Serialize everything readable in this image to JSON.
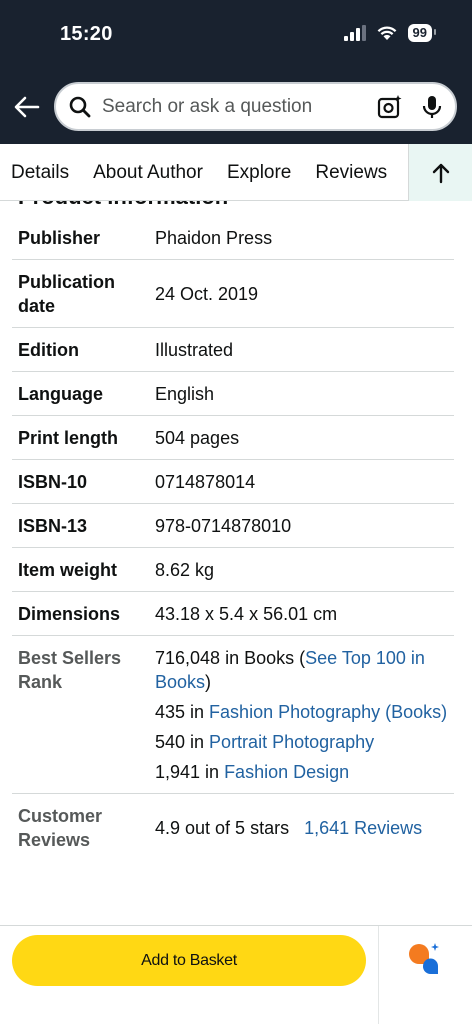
{
  "status_bar": {
    "time": "15:20",
    "battery": "99"
  },
  "search": {
    "placeholder": "Search or ask a question"
  },
  "tabs": [
    {
      "label": "Details"
    },
    {
      "label": "About Author"
    },
    {
      "label": "Explore"
    },
    {
      "label": "Reviews"
    }
  ],
  "section_title": "Product information",
  "details": {
    "publisher": {
      "key": "Publisher",
      "value": "Phaidon Press"
    },
    "publication_date": {
      "key": "Publication date",
      "value": "24 Oct. 2019"
    },
    "edition": {
      "key": "Edition",
      "value": "Illustrated"
    },
    "language": {
      "key": "Language",
      "value": "English"
    },
    "print_length": {
      "key": "Print length",
      "value": "504 pages"
    },
    "isbn10": {
      "key": "ISBN-10",
      "value": "0714878014"
    },
    "isbn13": {
      "key": "ISBN-13",
      "value": "978-0714878010"
    },
    "item_weight": {
      "key": "Item weight",
      "value": "8.62 kg"
    },
    "dimensions": {
      "key": "Dimensions",
      "value": "43.18 x 5.4 x 56.01 cm"
    }
  },
  "best_sellers": {
    "key": "Best Sellers Rank",
    "ranks": [
      {
        "prefix": "716,048 in Books (",
        "link": "See Top 100 in Books",
        "suffix": ")"
      },
      {
        "prefix": "435 in ",
        "link": "Fashion Photography (Books)",
        "suffix": ""
      },
      {
        "prefix": "540 in ",
        "link": "Portrait Photography",
        "suffix": ""
      },
      {
        "prefix": "1,941 in ",
        "link": "Fashion Design",
        "suffix": ""
      }
    ]
  },
  "customer_reviews": {
    "key": "Customer Reviews",
    "rating_text": "4.9 out of 5 stars",
    "count_link": "1,641 Reviews"
  },
  "footer": {
    "add_to_basket": "Add to Basket"
  },
  "colors": {
    "header_bg": "#19222f",
    "link": "#2162a1",
    "button": "#ffd814",
    "scroll_top_bg": "#e9f6f3"
  }
}
